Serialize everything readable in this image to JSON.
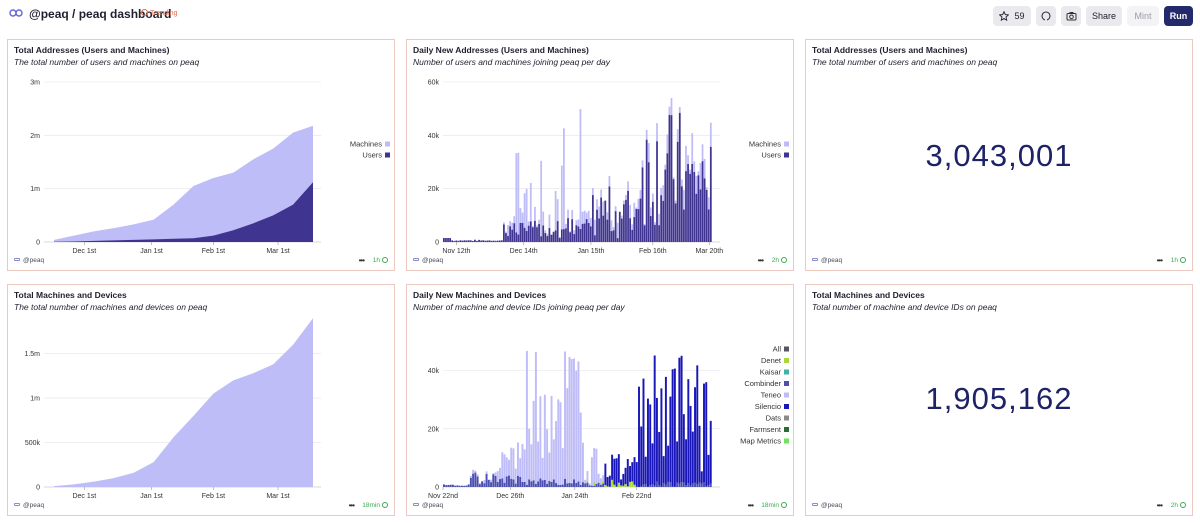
{
  "header": {
    "title": "@peaq / peaq dashboard",
    "badge": "Trending",
    "stars": "59",
    "share_label": "Share",
    "mint_label": "Mint",
    "run_label": "Run"
  },
  "colors": {
    "accent": "#232a6b",
    "light_series": "#bfbdf7",
    "dark_series": "#3f3590"
  },
  "panels": {
    "p1": {
      "title": "Total Addresses (Users and Machines)",
      "subtitle": "The total number of users and machines on peaq",
      "owner": "@peaq",
      "age": "1h"
    },
    "p2": {
      "title": "Daily New Addresses (Users and Machines)",
      "subtitle": "Number of users and machines joining peaq per day",
      "owner": "@peaq",
      "age": "2h"
    },
    "p3": {
      "title": "Total Addresses (Users and Machines)",
      "subtitle": "The total number of users and machines on peaq",
      "owner": "@peaq",
      "age": "1h",
      "value": "3,043,001"
    },
    "p4": {
      "title": "Total Machines and Devices",
      "subtitle": "The total number of machines and devices on peaq",
      "owner": "@peaq",
      "age": "18min"
    },
    "p5": {
      "title": "Daily New Machines and Devices",
      "subtitle": "Number of machine and device IDs joining peaq per day",
      "owner": "@peaq",
      "age": "18min"
    },
    "p6": {
      "title": "Total Machines and Devices",
      "subtitle": "Total number of machine and device IDs on peaq",
      "owner": "@peaq",
      "age": "2h",
      "value": "1,905,162"
    }
  },
  "chart_data": [
    {
      "type": "area",
      "ylim": [
        0,
        3000000
      ],
      "yticks": [
        "0",
        "1m",
        "2m",
        "3m"
      ],
      "xticks": [
        "Dec 1st",
        "Jan 1st",
        "Feb 1st",
        "Mar 1st"
      ],
      "legend": "right",
      "series": [
        {
          "name": "Machines",
          "color": "#bfbdf7",
          "x": [
            "Nov 10",
            "Nov 20",
            "Dec 1",
            "Dec 10",
            "Dec 20",
            "Jan 1",
            "Jan 10",
            "Jan 20",
            "Feb 1",
            "Feb 10",
            "Feb 20",
            "Mar 1",
            "Mar 10",
            "Mar 20"
          ],
          "values": [
            40000,
            120000,
            200000,
            260000,
            330000,
            420000,
            700000,
            1050000,
            1200000,
            1300000,
            1550000,
            1750000,
            2050000,
            2180000
          ]
        },
        {
          "name": "Users",
          "color": "#3f3590",
          "x": [
            "Nov 10",
            "Nov 20",
            "Dec 1",
            "Dec 10",
            "Dec 20",
            "Jan 1",
            "Jan 10",
            "Jan 20",
            "Feb 1",
            "Feb 10",
            "Feb 20",
            "Mar 1",
            "Mar 10",
            "Mar 20"
          ],
          "values": [
            5000,
            10000,
            20000,
            30000,
            40000,
            50000,
            60000,
            70000,
            120000,
            220000,
            350000,
            500000,
            700000,
            1120000
          ]
        }
      ]
    },
    {
      "type": "bar",
      "stacked": true,
      "ylim": [
        0,
        60000
      ],
      "yticks": [
        "0",
        "20k",
        "40k",
        "60k"
      ],
      "xticks": [
        "Nov 12th",
        "Dec 14th",
        "Jan 15th",
        "Feb 16th",
        "Mar 20th"
      ],
      "legend": "right",
      "series": [
        {
          "name": "Machines",
          "color": "#bfbdf7"
        },
        {
          "name": "Users",
          "color": "#3f3590"
        }
      ]
    },
    {
      "type": "area",
      "ylim": [
        0,
        1800000
      ],
      "yticks": [
        "0",
        "500k",
        "1m",
        "1.5m"
      ],
      "xticks": [
        "Dec 1st",
        "Jan 1st",
        "Feb 1st",
        "Mar 1st"
      ],
      "series": [
        {
          "color": "#bfbdf7",
          "x": [
            "Nov 10",
            "Nov 20",
            "Dec 1",
            "Dec 10",
            "Dec 20",
            "Jan 1",
            "Jan 10",
            "Jan 20",
            "Feb 1",
            "Feb 10",
            "Feb 20",
            "Mar 1",
            "Mar 10",
            "Mar 20"
          ],
          "values": [
            10000,
            30000,
            60000,
            100000,
            160000,
            280000,
            560000,
            800000,
            1050000,
            1200000,
            1280000,
            1380000,
            1600000,
            1900000
          ]
        }
      ]
    },
    {
      "type": "bar",
      "stacked": true,
      "ylim": [
        0,
        55000
      ],
      "yticks": [
        "0",
        "20k",
        "40k"
      ],
      "xticks": [
        "Nov 22nd",
        "Dec 26th",
        "Jan 24th",
        "Feb 22nd"
      ],
      "legend": "right",
      "series": [
        {
          "name": "All",
          "color": "#555566"
        },
        {
          "name": "Denet",
          "color": "#a8d83a"
        },
        {
          "name": "Kaisar",
          "color": "#41b3a3"
        },
        {
          "name": "Combinder",
          "color": "#4a4fb0"
        },
        {
          "name": "Teneo",
          "color": "#bfbdf7"
        },
        {
          "name": "Silencio",
          "color": "#1a17b8"
        },
        {
          "name": "Dats",
          "color": "#8a8a8a"
        },
        {
          "name": "Farmsent",
          "color": "#2a6b3a"
        },
        {
          "name": "Map Metrics",
          "color": "#6be35a"
        }
      ]
    }
  ]
}
